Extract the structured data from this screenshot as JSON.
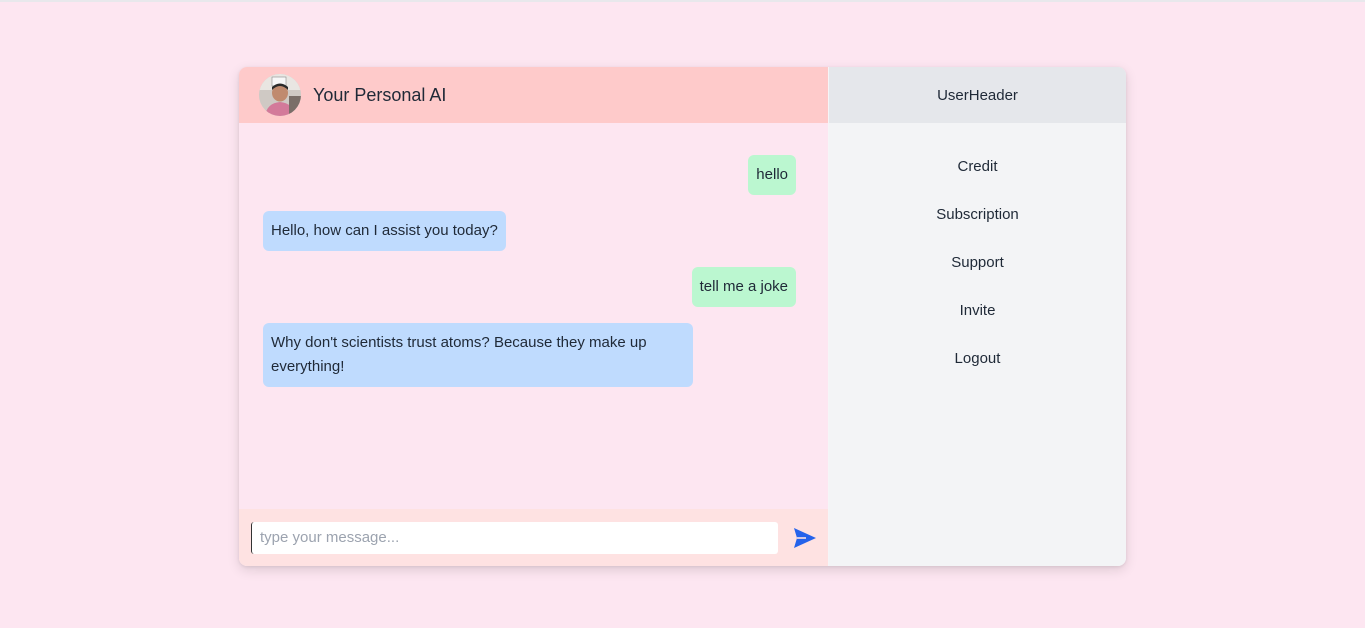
{
  "chat": {
    "title": "Your Personal AI",
    "messages": [
      {
        "role": "user",
        "text": "hello"
      },
      {
        "role": "ai",
        "text": "Hello, how can I assist you today?"
      },
      {
        "role": "user",
        "text": "tell me a joke"
      },
      {
        "role": "ai",
        "text": "Why don't scientists trust atoms? Because they make up everything!"
      }
    ],
    "input": {
      "value": "",
      "placeholder": "type your message..."
    },
    "send_icon": "send-icon"
  },
  "side": {
    "header": "UserHeader",
    "menu": [
      {
        "label": "Credit"
      },
      {
        "label": "Subscription"
      },
      {
        "label": "Support"
      },
      {
        "label": "Invite"
      },
      {
        "label": "Logout"
      }
    ]
  },
  "colors": {
    "page_bg": "#fde6f1",
    "chat_header_bg": "#fecaca",
    "user_bubble": "#bbf7d0",
    "ai_bubble": "#bfdbfe",
    "composer_bg": "#fee2e2",
    "side_bg": "#f3f4f6",
    "side_header_bg": "#e5e7eb",
    "send_icon": "#2563eb"
  }
}
